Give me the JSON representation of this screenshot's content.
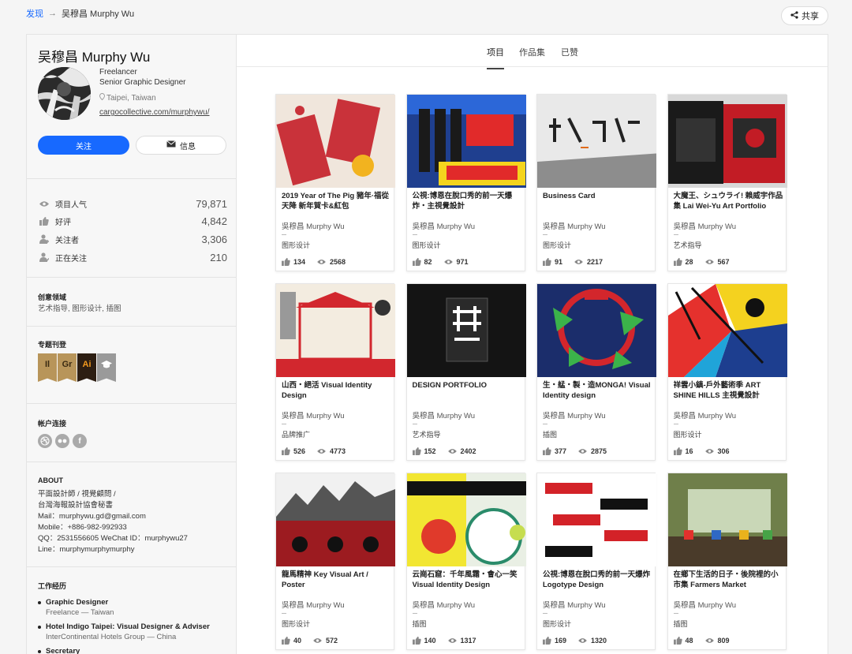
{
  "breadcrumb": {
    "link": "发现",
    "arrow": "→",
    "current": "吴穆昌 Murphy Wu"
  },
  "share_label": "共享",
  "profile": {
    "name": "吴穆昌 Murphy Wu",
    "role1": "Freelancer",
    "role2": "Senior Graphic Designer",
    "location": "Taipei, Taiwan",
    "website": "cargocollective.com/murphywu/",
    "follow_label": "关注",
    "message_label": "信息"
  },
  "stats": [
    {
      "label": "项目人气",
      "value": "79,871",
      "icon": "eye-icon"
    },
    {
      "label": "好评",
      "value": "4,842",
      "icon": "thumbs-up-icon"
    },
    {
      "label": "关注者",
      "value": "3,306",
      "icon": "follower-icon"
    },
    {
      "label": "正在关注",
      "value": "210",
      "icon": "following-icon"
    }
  ],
  "creative_fields": {
    "title": "创意领域",
    "text": "艺术指导, 图形设计, 插图"
  },
  "featured": {
    "title": "专题刊登",
    "badges": [
      {
        "text": "Il",
        "bg": "#b8955a",
        "fg": "#3a2a12"
      },
      {
        "text": "Gr",
        "bg": "#b8955a",
        "fg": "#3a2a12"
      },
      {
        "text": "Ai",
        "bg": "#2d1e12",
        "fg": "#f39a1e"
      },
      {
        "text": "",
        "bg": "#9a9a9a",
        "fg": "#ffffff"
      }
    ]
  },
  "connections": {
    "title": "帐户连接",
    "items": [
      "dribbble-icon",
      "flickr-icon",
      "facebook-icon"
    ],
    "facebook_glyph": "f"
  },
  "about": {
    "title": "ABOUT",
    "lines": [
      "平面設計師 / 視覺顧問 /",
      "台灣海報設計協會秘書",
      "Mail：murphywu.gd@gmail.com",
      "Mobile：+886-982-992933",
      "QQ：2531556605 WeChat ID：murphywu27",
      "Line：murphymurphymurphy"
    ]
  },
  "work": {
    "title": "工作经历",
    "items": [
      {
        "title": "Graphic Designer",
        "sub": "Freelance — Taiwan"
      },
      {
        "title": "Hotel Indigo Taipei: Visual Designer & Adviser",
        "sub": "InterContinental Hotels Group — China"
      },
      {
        "title": "Secretary",
        "sub": ""
      }
    ]
  },
  "tabs": [
    "项目",
    "作品集",
    "已赞"
  ],
  "projects": [
    {
      "title": "2019 Year of The Pig 豬年·福從天降 新年賀卡&紅包",
      "author": "吳穆昌 Murphy Wu",
      "category": "图形设计",
      "likes": "134",
      "views": "2568",
      "colors": [
        "#c9323a",
        "#f0e6dc"
      ]
    },
    {
      "title": "公視:博恩在脫口秀的前一天爆炸・主視覺設計",
      "author": "吳穆昌 Murphy Wu",
      "category": "图形设计",
      "likes": "82",
      "views": "971",
      "colors": [
        "#1f3f8f",
        "#e12a2a"
      ]
    },
    {
      "title": "Business Card",
      "author": "吳穆昌 Murphy Wu",
      "category": "图形设计",
      "likes": "91",
      "views": "2217",
      "colors": [
        "#8d8d8d",
        "#e9e9e9"
      ]
    },
    {
      "title": "大魔王、シュウライ! 賴威宇作品集 Lai Wei-Yu Art Portfolio",
      "author": "吳穆昌 Murphy Wu",
      "category": "艺术指导",
      "likes": "28",
      "views": "567",
      "colors": [
        "#c21c25",
        "#1a1a1a"
      ]
    },
    {
      "title": "山西・絕活 Visual Identity Design",
      "author": "吳穆昌 Murphy Wu",
      "category": "品牌推广",
      "likes": "526",
      "views": "4773",
      "colors": [
        "#d2272e",
        "#f3ece0"
      ]
    },
    {
      "title": "DESIGN PORTFOLIO",
      "author": "吳穆昌 Murphy Wu",
      "category": "艺术指导",
      "likes": "152",
      "views": "2402",
      "colors": [
        "#141414",
        "#2a2a2a"
      ]
    },
    {
      "title": "生・艋・製・造MONGA! Visual Identity design",
      "author": "吳穆昌 Murphy Wu",
      "category": "插图",
      "likes": "377",
      "views": "2875",
      "colors": [
        "#1b2d6b",
        "#d3262c"
      ]
    },
    {
      "title": "祥雲小鎮-戶外藝術季 ART SHINE HILLS 主視覺設計",
      "author": "吳穆昌 Murphy Wu",
      "category": "图形设计",
      "likes": "16",
      "views": "306",
      "colors": [
        "#e5312d",
        "#f4d21f"
      ]
    },
    {
      "title": "龍馬精神 Key Visual Art / Poster",
      "author": "吳穆昌 Murphy Wu",
      "category": "图形设计",
      "likes": "40",
      "views": "572",
      "colors": [
        "#f1f1f1",
        "#9c1b20"
      ]
    },
    {
      "title": "云崗石窟：千年風霜・會心一笑 Visual Identity Design",
      "author": "吳穆昌 Murphy Wu",
      "category": "插图",
      "likes": "140",
      "views": "1317",
      "colors": [
        "#f2e632",
        "#e9efe4"
      ]
    },
    {
      "title": "公視:博恩在脫口秀的前一天爆炸 Logotype Design",
      "author": "吳穆昌 Murphy Wu",
      "category": "图形设计",
      "likes": "169",
      "views": "1320",
      "colors": [
        "#ffffff",
        "#d32228"
      ]
    },
    {
      "title": "在鄉下生活的日子・後院裡的小市集 Farmers Market",
      "author": "吳穆昌 Murphy Wu",
      "category": "插图",
      "likes": "48",
      "views": "809",
      "colors": [
        "#6f7f4a",
        "#c9d7b7"
      ]
    }
  ]
}
